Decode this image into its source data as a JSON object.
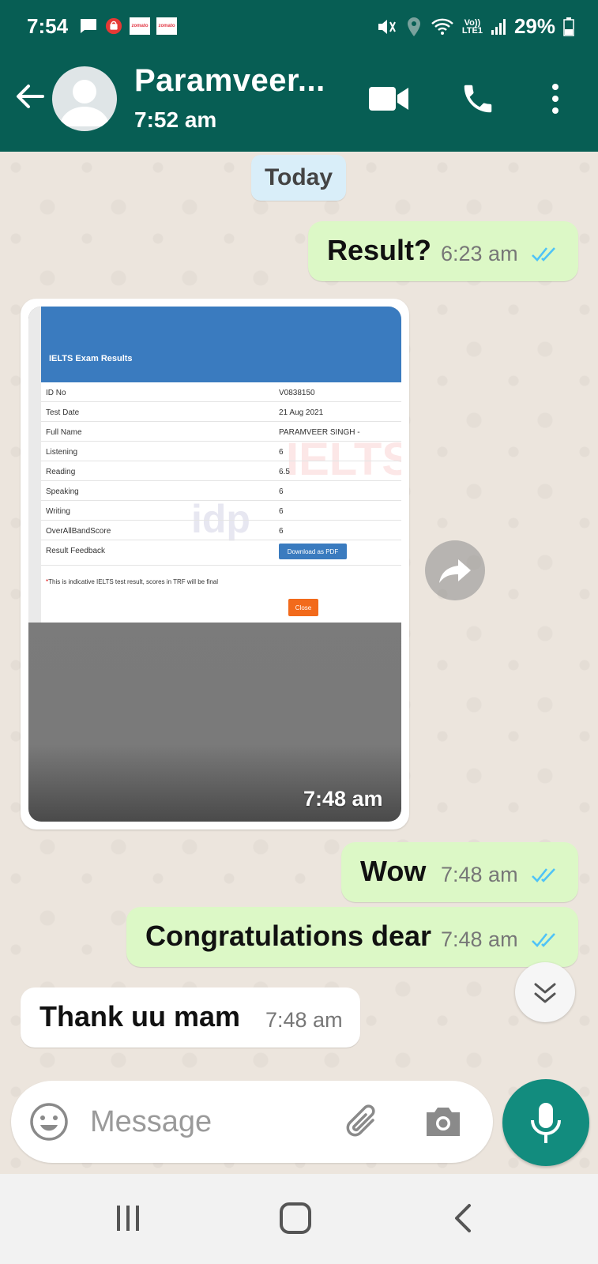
{
  "status_bar": {
    "time": "7:54",
    "network_label_top": "Vo))",
    "network_label_bottom": "LTE1",
    "battery": "29%",
    "notification_icons": [
      "message-icon",
      "shopping-bag-icon",
      "zomato-icon",
      "zomato-icon"
    ],
    "zomato_text": "zomato"
  },
  "header": {
    "contact_name": "Paramveer...",
    "last_seen": "7:52 am"
  },
  "chat": {
    "date_chip": "Today",
    "messages": [
      {
        "direction": "out",
        "text": "Result?",
        "time": "6:23 am",
        "status": "read"
      },
      {
        "direction": "in",
        "type": "image",
        "time": "7:48 am"
      },
      {
        "direction": "out",
        "text": "Wow",
        "time": "7:48 am",
        "status": "read"
      },
      {
        "direction": "out",
        "text": "Congratulations dear",
        "time": "7:48 am",
        "status": "read"
      },
      {
        "direction": "in",
        "text": "Thank uu mam",
        "time": "7:48 am"
      }
    ],
    "image_content": {
      "title": "IELTS Exam Results",
      "rows": [
        {
          "label": "ID No",
          "value": "V0838150"
        },
        {
          "label": "Test Date",
          "value": "21 Aug 2021"
        },
        {
          "label": "Full Name",
          "value": "PARAMVEER SINGH -"
        },
        {
          "label": "Listening",
          "value": "6"
        },
        {
          "label": "Reading",
          "value": "6.5"
        },
        {
          "label": "Speaking",
          "value": "6"
        },
        {
          "label": "Writing",
          "value": "6"
        },
        {
          "label": "OverAllBandScore",
          "value": "6"
        },
        {
          "label": "Result Feedback",
          "value": ""
        }
      ],
      "download_button": "Download as PDF",
      "note_star": "*",
      "note": "This is indicative IELTS test result, scores in TRF will be final",
      "close_button": "Close",
      "watermark_idp": "idp",
      "watermark_ielts": "IELTS"
    }
  },
  "input_bar": {
    "placeholder": "Message"
  },
  "colors": {
    "header": "#075e54",
    "outgoing_bubble": "#dcf8c6",
    "incoming_bubble": "#ffffff",
    "read_ticks": "#4fc3f7",
    "mic_button": "#128c7e",
    "date_chip": "#d9eef9"
  }
}
